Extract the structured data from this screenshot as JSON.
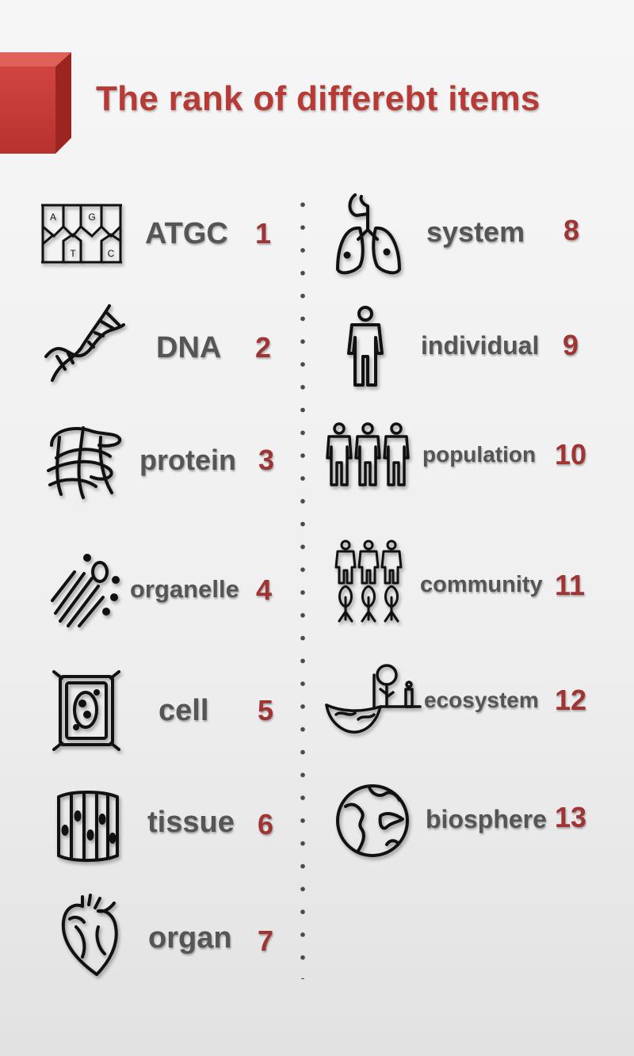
{
  "title": "The rank of differebt items",
  "colors": {
    "accent": "#b63a36",
    "rank": "#9e3433",
    "label": "#555555",
    "icon": "#111111"
  },
  "items": [
    {
      "label": "ATGC",
      "rank": "1",
      "icon": "atgc-blocks-icon"
    },
    {
      "label": "DNA",
      "rank": "2",
      "icon": "dna-helix-icon"
    },
    {
      "label": "protein",
      "rank": "3",
      "icon": "protein-fold-icon"
    },
    {
      "label": "organelle",
      "rank": "4",
      "icon": "organelle-icon"
    },
    {
      "label": "cell",
      "rank": "5",
      "icon": "cell-icon"
    },
    {
      "label": "tissue",
      "rank": "6",
      "icon": "tissue-icon"
    },
    {
      "label": "organ",
      "rank": "7",
      "icon": "heart-icon"
    },
    {
      "label": "system",
      "rank": "8",
      "icon": "lungs-icon"
    },
    {
      "label": "individual",
      "rank": "9",
      "icon": "person-icon"
    },
    {
      "label": "population",
      "rank": "10",
      "icon": "people-group-icon"
    },
    {
      "label": "community",
      "rank": "11",
      "icon": "people-trees-icon"
    },
    {
      "label": "ecosystem",
      "rank": "12",
      "icon": "ecosystem-icon"
    },
    {
      "label": "biosphere",
      "rank": "13",
      "icon": "globe-icon"
    }
  ]
}
